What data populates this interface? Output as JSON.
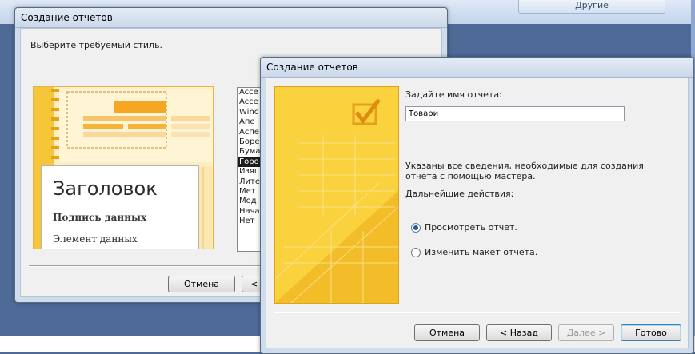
{
  "background": {
    "tab_label": "Другие"
  },
  "back_dialog": {
    "title": "Создание отчетов",
    "prompt": "Выберите требуемый стиль.",
    "preview": {
      "heading": "Заголовок",
      "data_label": "Подпись данных",
      "data_element": "Элемент данных"
    },
    "style_list": [
      "Acce",
      "Acce",
      "Winc",
      "Апе",
      "Аспе",
      "Боре",
      "Бума",
      "Горо",
      "Изящ",
      "Лите",
      "Мет",
      "Мод",
      "Нача",
      "Нет"
    ],
    "selected_style_index": 7,
    "buttons": {
      "cancel": "Отмена",
      "back": "< Н"
    }
  },
  "front_dialog": {
    "title": "Создание отчетов",
    "name_prompt": "Задайте имя отчета:",
    "report_name": "Товари",
    "info_text": "Указаны все сведения, необходимые для создания отчета с помощью мастера.",
    "next_actions": "Дальнейшие действия:",
    "options": [
      {
        "label": "Просмотреть отчет.",
        "selected": true
      },
      {
        "label": "Изменить макет отчета.",
        "selected": false
      }
    ],
    "buttons": {
      "cancel": "Отмена",
      "back": "< Назад",
      "next": "Далее >",
      "finish": "Готово"
    }
  },
  "colors": {
    "accent_yellow": "#f8cf3a",
    "desktop_blue": "#4e6b98",
    "selection": "#1c1c1c"
  }
}
